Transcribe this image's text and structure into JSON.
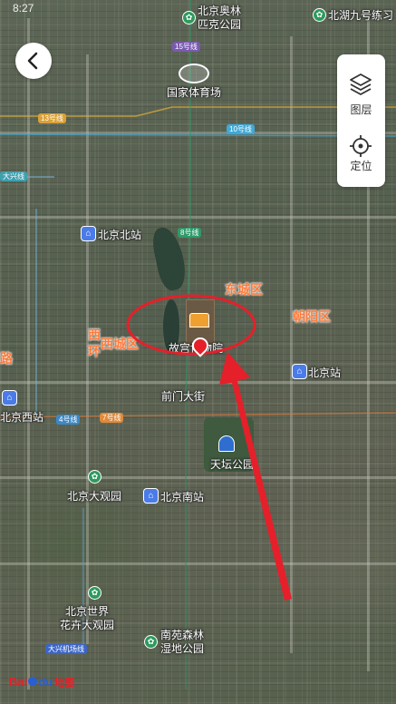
{
  "status_bar": {
    "time": "8:27"
  },
  "controls": {
    "back_icon": "chevron-left-icon",
    "layers_label": "图层",
    "locate_label": "定位"
  },
  "pois": {
    "olympic_park": "北京奥林\n匹克公园",
    "beihai_jiuhao": "北湖九号练习",
    "national_stadium": "国家体育场",
    "beijing_north": "北京北站",
    "forbidden_city": "故宫博物院",
    "beijing_station": "北京站",
    "qianmen": "前门大街",
    "beijing_west": "北京西站",
    "temple_of_heaven": "天坛公园",
    "beijing_daguanyuan": "北京大观园",
    "beijing_south": "北京南站",
    "world_flower": "北京世界\n花卉大观园",
    "nanyuan_park": "南苑森林\n湿地公园"
  },
  "districts": {
    "dongcheng": "东城区",
    "xicheng": "西城区",
    "chaoyang": "朝阳区",
    "xihuan": "西\n环",
    "lu": "路"
  },
  "lines": {
    "l15": "15号线",
    "l13": "13号线",
    "l10": "10号线",
    "ldaxing": "大兴线",
    "l8": "8号线",
    "l4": "4号线",
    "l7": "7号线",
    "ldaxing_airport": "大兴机场线"
  },
  "logo": {
    "bai": "Bai",
    "du": "du",
    "map": "地图"
  },
  "colors": {
    "annotation_red": "#e5202a",
    "district_orange": "#ff7a3a",
    "station_blue": "#4a7be8",
    "park_green": "#2e9a5e"
  }
}
